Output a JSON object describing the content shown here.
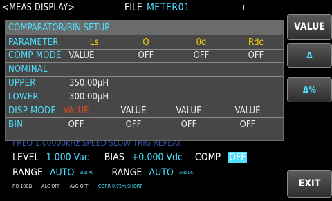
{
  "topbar": {
    "mode": "<MEAS DISPLAY>",
    "file_label": "FILE",
    "file_name": "METER01"
  },
  "softkeys": {
    "value": "VALUE",
    "delta": "Δ",
    "delta_pct": "Δ%",
    "exit": "EXIT"
  },
  "panel": {
    "title": "COMPARATOR/BIN SETUP",
    "rows": {
      "parameter": {
        "label": "PARAMETER",
        "cols": [
          "Ls",
          "Q",
          "θd",
          "Rdc"
        ]
      },
      "comp_mode": {
        "label": "COMP MODE",
        "cols": [
          "VALUE",
          "OFF",
          "OFF",
          "OFF"
        ]
      },
      "nominal": {
        "label": "NOMINAL",
        "value": ""
      },
      "upper": {
        "label": "UPPER",
        "value": "350.00µH"
      },
      "lower": {
        "label": "LOWER",
        "value": "300.00µH"
      },
      "disp_mode": {
        "label": "DISP MODE",
        "cols": [
          "VALUE",
          "VALUE",
          "VALUE",
          "VALUE"
        ]
      },
      "bin": {
        "label": "BIN",
        "cols": [
          "OFF",
          "OFF",
          "OFF",
          "OFF"
        ]
      }
    }
  },
  "meas": {
    "hidden_row": "FREQ  1.00000kHz    SPEED SLOW              TRIG REPEAT",
    "level_label": "LEVEL",
    "level_value": "1.000 Vac",
    "bias_label": "BIAS",
    "bias_value": "+0.000 Vdc",
    "comp_label": "COMP",
    "comp_value": "OFF",
    "range1_label": "RANGE",
    "range1_value": "AUTO",
    "range1_sub": "30Ω  AC",
    "range2_label": "RANGE",
    "range2_value": "AUTO",
    "range2_sub": "30Ω  DC",
    "status_ro": "RO 100Ω",
    "status_alc": "ALC OFF",
    "status_avg": "AVG OFF",
    "status_corr": "CORR 0.75m,SHORT"
  },
  "colors": {
    "accent_cyan": "#4de0ff",
    "header_yellow": "#ffd600",
    "alert_red": "#e0451e",
    "panel_bg": "#474747"
  }
}
